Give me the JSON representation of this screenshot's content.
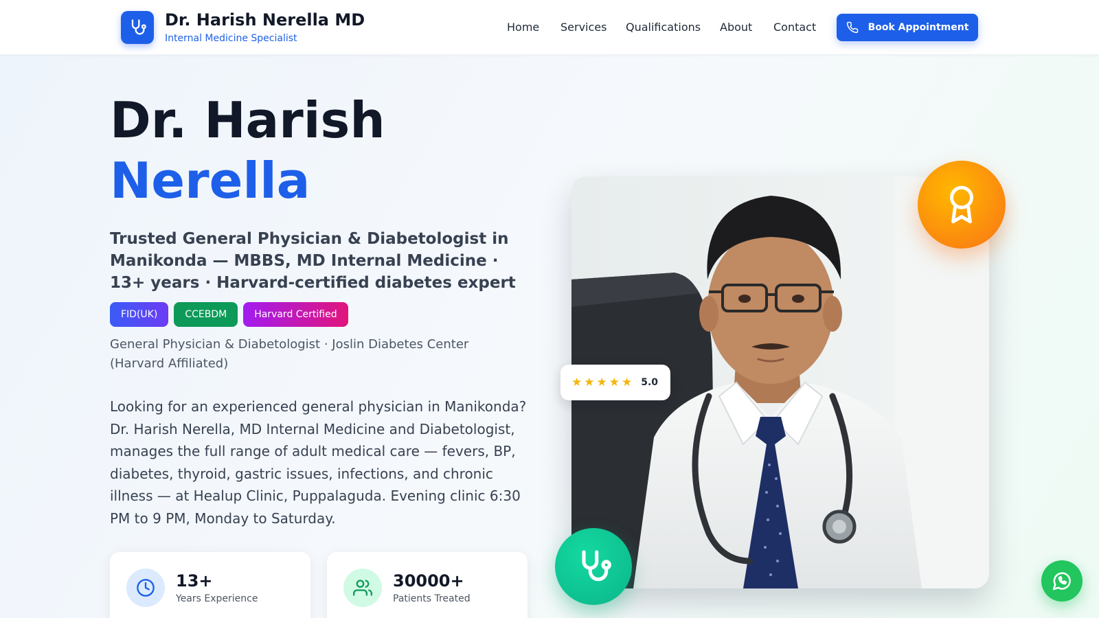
{
  "header": {
    "brand_name": "Dr. Harish Nerella MD",
    "brand_subtitle": "Internal Medicine Specialist",
    "nav": [
      {
        "label": "Home"
      },
      {
        "label": "Services"
      },
      {
        "label": "Qualifications"
      },
      {
        "label": "About"
      },
      {
        "label": "Contact"
      }
    ],
    "cta_label": "Book Appointment"
  },
  "hero": {
    "title_line1": "Dr. Harish",
    "title_line2": "Nerella",
    "tagline": "Trusted General Physician & Diabetologist in Manikonda — MBBS, MD Internal Medicine · 13+ years · Harvard-certified diabetes expert",
    "badges": [
      {
        "label": "FID(UK)"
      },
      {
        "label": "CCEBDM"
      },
      {
        "label": "Harvard Certified"
      }
    ],
    "affiliation": "General Physician & Diabetologist · Joslin Diabetes Center (Harvard Affiliated)",
    "description": "Looking for an experienced general physician in Manikonda? Dr. Harish Nerella, MD Internal Medicine and Diabetologist, manages the full range of adult medical care — fevers, BP, diabetes, thyroid, gastric issues, infections, and chronic illness — at Healup Clinic, Puppalaguda. Evening clinic 6:30 PM to 9 PM, Monday to Saturday.",
    "stats": [
      {
        "value": "13+",
        "label": "Years Experience",
        "icon": "clock-icon"
      },
      {
        "value": "30000+",
        "label": "Patients Treated",
        "icon": "users-icon"
      }
    ],
    "rating": {
      "stars": 5,
      "value": "5.0"
    }
  },
  "colors": {
    "primary": "#1d5fe8",
    "award": "#f97316",
    "stethoscope_badge": "#10b981",
    "whatsapp": "#22c55e"
  }
}
